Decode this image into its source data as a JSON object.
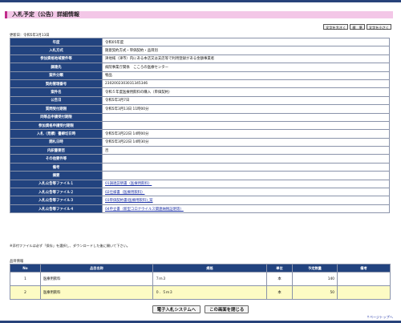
{
  "page": {
    "title": "入札予定（公告）詳細情報",
    "updated": "更新日：令和5年3月13日"
  },
  "fontsize": {
    "large": "文字を大きく",
    "normal": "標　準",
    "small": "文字を小さく"
  },
  "details": [
    {
      "label": "年度",
      "value": "令和05年度"
    },
    {
      "label": "入札方式",
      "value": "随意契約方式・単価契約・品目別"
    },
    {
      "label": "参加資格地域要件等",
      "value": "津地域（津市）内にある本店又は支店等で利用登録がある金額事業者"
    },
    {
      "label": "調達先",
      "value": "病院事業庁関係　こころの医療センター"
    },
    {
      "label": "案件分類",
      "value": "物品"
    },
    {
      "label": "契約管理番号",
      "value": "2302002303031345346"
    },
    {
      "label": "案件名",
      "value": "令和５年度医療用飲料の購入（単価契約）"
    },
    {
      "label": "公告日",
      "value": "令和5年3月7日"
    },
    {
      "label": "質問受付期限",
      "value": "令和5年3月13日 11時00分"
    },
    {
      "label": "同等品申請受付期限",
      "value": ""
    },
    {
      "label": "参加資格申請受付期限",
      "value": ""
    },
    {
      "label": "入札（見積）書締切日時",
      "value": "令和5年3月22日 14時00分"
    },
    {
      "label": "開札日時",
      "value": "令和5年3月22日 14時30分"
    },
    {
      "label": "内訳書要否",
      "value": "否"
    },
    {
      "label": "その他要件等",
      "value": ""
    },
    {
      "label": "備考",
      "value": ""
    },
    {
      "label": "摘要",
      "value": ""
    },
    {
      "label": "入札公告等ファイル１",
      "value": "01調達説明書（医療用飲料）",
      "link": true
    },
    {
      "label": "入札公告等ファイル２",
      "value": "02仕様書（医療用飲料）",
      "link": true
    },
    {
      "label": "入札公告等ファイル３",
      "value": "03単価契約書(医療用飲料)_案",
      "link": true
    },
    {
      "label": "入札公告等ファイル４",
      "value": "04申立書（新型コロナウイルス関連納税証明等）",
      "link": true
    }
  ],
  "note": "※添付ファイルは必ず「保存」を選択し、ダウンロードした後に開いて下さい。",
  "items": {
    "section_label": "品目情報",
    "headers": [
      "No",
      "品目名称",
      "規格",
      "単位",
      "予定数量",
      "備考"
    ],
    "rows": [
      {
        "no": "1",
        "name": "医療用飲料",
        "spec": "７ｍ３",
        "unit": "本",
        "qty": "140",
        "note": ""
      },
      {
        "no": "2",
        "name": "医療用飲料",
        "spec": "０．５ｍ３",
        "unit": "本",
        "qty": "50",
        "note": ""
      }
    ]
  },
  "actions": {
    "system": "電子入札システムへ",
    "close": "この画面を閉じる"
  },
  "pagetop": "↑ページトップへ"
}
